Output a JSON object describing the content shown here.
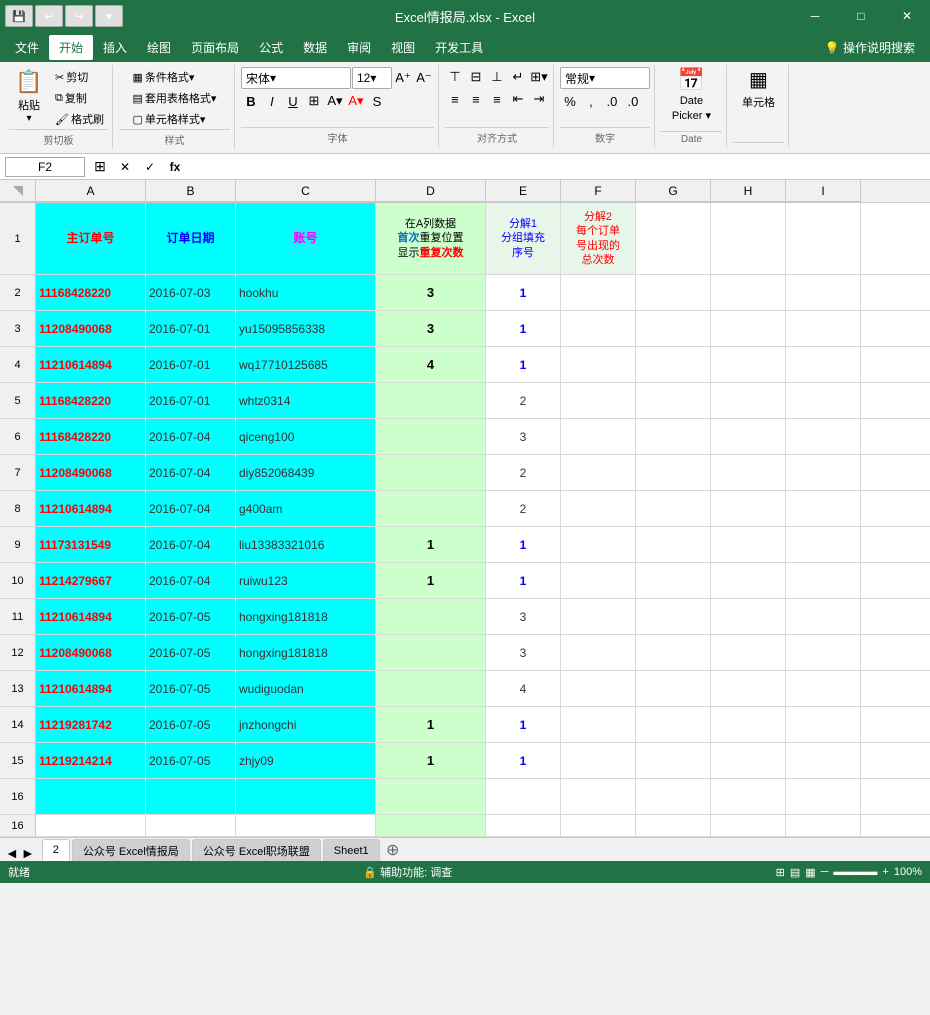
{
  "titleBar": {
    "title": "Excel情报局.xlsx - Excel",
    "winControls": [
      "─",
      "□",
      "✕"
    ]
  },
  "menuBar": {
    "items": [
      "文件",
      "开始",
      "插入",
      "绘图",
      "页面布局",
      "公式",
      "数据",
      "审阅",
      "视图",
      "开发工具",
      "💡 操作说明搜索"
    ],
    "active": "开始"
  },
  "ribbon": {
    "groups": [
      {
        "label": "剪切板",
        "name": "clipboard"
      },
      {
        "label": "样式",
        "name": "style"
      },
      {
        "label": "字体",
        "name": "font"
      },
      {
        "label": "对齐方式",
        "name": "alignment"
      },
      {
        "label": "数字",
        "name": "number"
      },
      {
        "label": "Date",
        "name": "date"
      },
      {
        "label": "",
        "name": "cells"
      }
    ],
    "font": {
      "name": "宋体",
      "size": "12"
    }
  },
  "formulaBar": {
    "cellRef": "F2",
    "formula": ""
  },
  "columns": [
    "A",
    "B",
    "C",
    "D",
    "E",
    "F",
    "G",
    "H",
    "I"
  ],
  "headerRow": {
    "a": "主订单号",
    "b": "订单日期",
    "c": "账号",
    "d_line1": "在A列数据",
    "d_line2": "首次",
    "d_line3": "重复位置",
    "d_line4": "显示",
    "d_line5": "重复次数",
    "e": "分解1\n分组填充\n序号",
    "f_line1": "分解2",
    "f_line2": "每个订单",
    "f_line3": "号出现的",
    "f_line4": "总次数"
  },
  "rows": [
    {
      "num": "2",
      "a": "11168428220",
      "b": "2016-07-03",
      "c": "hookhu",
      "d": "3",
      "d_has_value": true,
      "e": "1",
      "e_blue": true,
      "f": ""
    },
    {
      "num": "3",
      "a": "11208490068",
      "b": "2016-07-01",
      "c": "yu15095856338",
      "d": "3",
      "d_has_value": true,
      "e": "1",
      "e_blue": true,
      "f": ""
    },
    {
      "num": "4",
      "a": "11210614894",
      "b": "2016-07-01",
      "c": "wq17710125685",
      "d": "4",
      "d_has_value": true,
      "e": "1",
      "e_blue": true,
      "f": ""
    },
    {
      "num": "5",
      "a": "11168428220",
      "b": "2016-07-01",
      "c": "whtz0314",
      "d": "",
      "d_has_value": false,
      "e": "2",
      "e_blue": false,
      "f": ""
    },
    {
      "num": "6",
      "a": "11168428220",
      "b": "2016-07-04",
      "c": "qiceng100",
      "d": "",
      "d_has_value": false,
      "e": "3",
      "e_blue": false,
      "f": ""
    },
    {
      "num": "7",
      "a": "11208490068",
      "b": "2016-07-04",
      "c": "diy852068439",
      "d": "",
      "d_has_value": false,
      "e": "2",
      "e_blue": false,
      "f": ""
    },
    {
      "num": "8",
      "a": "11210614894",
      "b": "2016-07-04",
      "c": "g400am",
      "d": "",
      "d_has_value": false,
      "e": "2",
      "e_blue": false,
      "f": ""
    },
    {
      "num": "9",
      "a": "11173131549",
      "b": "2016-07-04",
      "c": "liu13383321016",
      "d": "1",
      "d_has_value": true,
      "e": "1",
      "e_blue": true,
      "f": ""
    },
    {
      "num": "10",
      "a": "11214279667",
      "b": "2016-07-04",
      "c": "ruiwu123",
      "d": "1",
      "d_has_value": true,
      "e": "1",
      "e_blue": true,
      "f": ""
    },
    {
      "num": "11",
      "a": "11210614894",
      "b": "2016-07-05",
      "c": "hongxing181818",
      "d": "",
      "d_has_value": false,
      "e": "3",
      "e_blue": false,
      "f": ""
    },
    {
      "num": "12",
      "a": "11208490068",
      "b": "2016-07-05",
      "c": "hongxing181818",
      "d": "",
      "d_has_value": false,
      "e": "3",
      "e_blue": false,
      "f": ""
    },
    {
      "num": "13",
      "a": "11210614894",
      "b": "2016-07-05",
      "c": "wudiguodan",
      "d": "",
      "d_has_value": false,
      "e": "4",
      "e_blue": false,
      "f": ""
    },
    {
      "num": "14",
      "a": "11219281742",
      "b": "2016-07-05",
      "c": "jnzhongchi",
      "d": "1",
      "d_has_value": true,
      "e": "1",
      "e_blue": true,
      "f": ""
    },
    {
      "num": "15",
      "a": "11219214214",
      "b": "2016-07-05",
      "c": "zhjy09",
      "d": "1",
      "d_has_value": true,
      "e": "1",
      "e_blue": true,
      "f": ""
    },
    {
      "num": "16",
      "a": "",
      "b": "",
      "c": "",
      "d": "",
      "d_has_value": false,
      "e": "",
      "e_blue": false,
      "f": ""
    }
  ],
  "sheetTabs": [
    "2",
    "公众号 Excel情报局",
    "公众号 Excel职场联盟",
    "Sheet1"
  ],
  "activeSheet": "2",
  "statusBar": {
    "left": "就绪",
    "middle": "🔒 辅助功能: 调查",
    "right": [
      "⊞",
      "─",
      "+"
    ]
  },
  "colors": {
    "cyan": "#00ffff",
    "lightGreen": "#ccffcc",
    "ribbonGreen": "#217346",
    "blue": "#0000ff",
    "red": "#ff0000",
    "magenta": "#ff00ff"
  }
}
